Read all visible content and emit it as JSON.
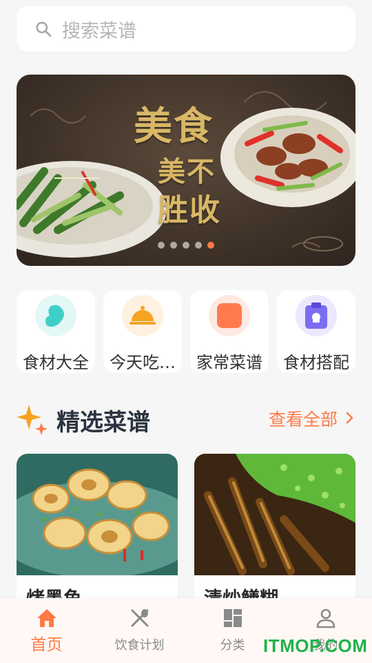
{
  "search": {
    "placeholder": "搜索菜谱"
  },
  "banner": {
    "line1": "美食",
    "line2": "美不",
    "line3": "胜收",
    "dots": 5,
    "active_dot": 5
  },
  "categories": [
    {
      "label": "食材大全",
      "icon": "ingredient-icon",
      "bg": "#e3f7f6",
      "color": "#3fcfc8"
    },
    {
      "label": "今天吃…",
      "icon": "food-cloche-icon",
      "bg": "#fff1df",
      "color": "#f6a322"
    },
    {
      "label": "家常菜谱",
      "icon": "recipe-square-icon",
      "bg": "#ffe9e3",
      "color": "#ff7a4f"
    },
    {
      "label": "食材搭配",
      "icon": "clipboard-icon",
      "bg": "#ece8ff",
      "color": "#7c6cf2"
    }
  ],
  "section": {
    "title": "精选菜谱",
    "more": "查看全部"
  },
  "recipes": [
    {
      "name": "烤墨鱼"
    },
    {
      "name": "清炒鳝糊"
    }
  ],
  "nav": [
    {
      "label": "首页",
      "icon": "home-icon",
      "active": true
    },
    {
      "label": "饮食计划",
      "icon": "utensils-icon",
      "active": false
    },
    {
      "label": "分类",
      "icon": "category-grid-icon",
      "active": false
    },
    {
      "label": "我的",
      "icon": "user-icon",
      "active": false
    }
  ],
  "watermark": "ITMOP.COM",
  "colors": {
    "accent": "#ff7a45",
    "title": "#2b3340"
  }
}
